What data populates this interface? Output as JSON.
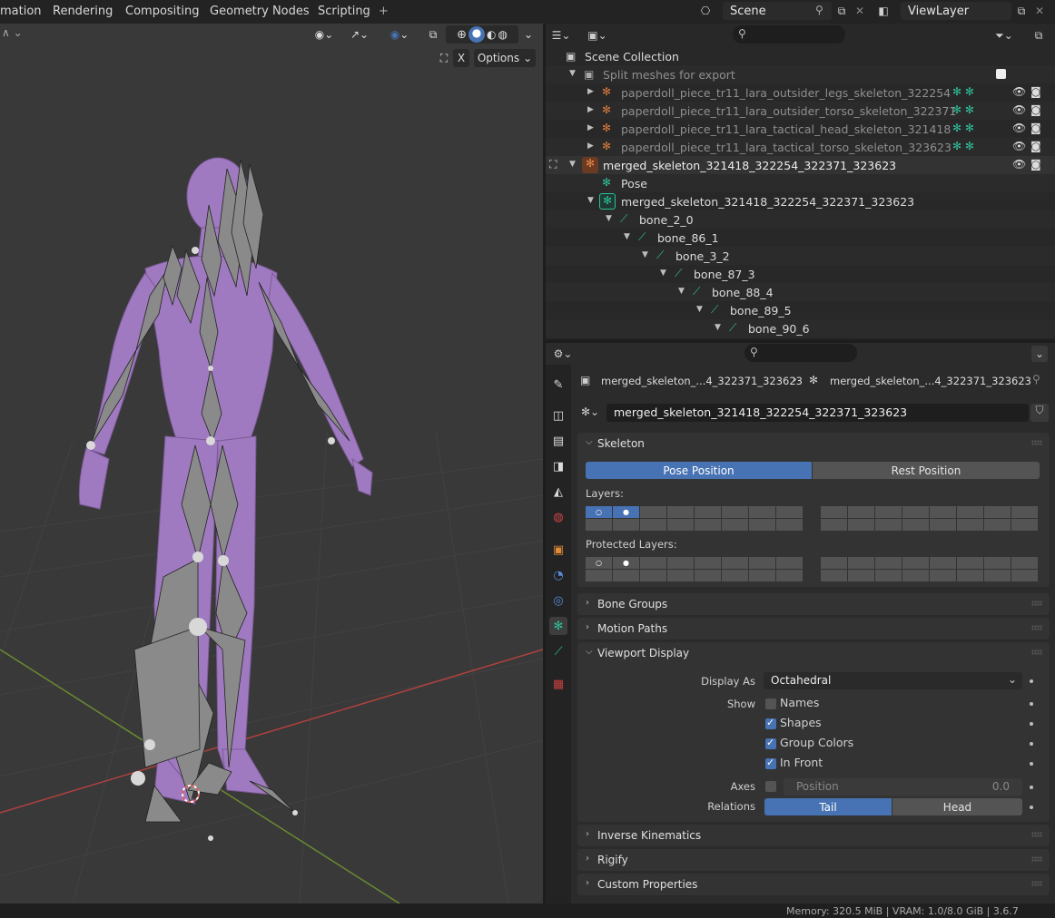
{
  "topbar": {
    "tabs": [
      "mation",
      "Rendering",
      "Compositing",
      "Geometry Nodes",
      "Scripting",
      "+"
    ],
    "scene": "Scene",
    "view_layer": "ViewLayer"
  },
  "viewport": {
    "options_label": "Options",
    "x_label": "X"
  },
  "outliner": {
    "rows": [
      {
        "label": "Scene Collection",
        "style": "normal"
      },
      {
        "label": "Split meshes for export",
        "style": "dim"
      },
      {
        "label": "paperdoll_piece_tr11_lara_outsider_legs_skeleton_322254",
        "style": "dim"
      },
      {
        "label": "paperdoll_piece_tr11_lara_outsider_torso_skeleton_322371",
        "style": "dim"
      },
      {
        "label": "paperdoll_piece_tr11_lara_tactical_head_skeleton_321418",
        "style": "dim"
      },
      {
        "label": "paperdoll_piece_tr11_lara_tactical_torso_skeleton_323623",
        "style": "dim"
      },
      {
        "label": "merged_skeleton_321418_322254_322371_323623",
        "style": "normal"
      },
      {
        "label": "Pose",
        "style": "normal"
      },
      {
        "label": "merged_skeleton_321418_322254_322371_323623",
        "style": "normal"
      },
      {
        "label": "bone_2_0",
        "style": "normal"
      },
      {
        "label": "bone_86_1",
        "style": "normal"
      },
      {
        "label": "bone_3_2",
        "style": "normal"
      },
      {
        "label": "bone_87_3",
        "style": "normal"
      },
      {
        "label": "bone_88_4",
        "style": "normal"
      },
      {
        "label": "bone_89_5",
        "style": "normal"
      },
      {
        "label": "bone_90_6",
        "style": "normal"
      }
    ]
  },
  "properties": {
    "breadcrumb_object": "merged_skeleton_...4_322371_323623",
    "breadcrumb_data": "merged_skeleton_...4_322371_323623",
    "datablock_name": "merged_skeleton_321418_322254_322371_323623",
    "skeleton": {
      "title": "Skeleton",
      "pose_position": "Pose Position",
      "rest_position": "Rest Position",
      "layers_label": "Layers:",
      "protected_label": "Protected Layers:"
    },
    "panels": {
      "bone_groups": "Bone Groups",
      "motion_paths": "Motion Paths",
      "viewport_display": "Viewport Display",
      "inverse_kinematics": "Inverse Kinematics",
      "rigify": "Rigify",
      "custom_properties": "Custom Properties"
    },
    "viewport_display": {
      "display_as_label": "Display As",
      "display_as_value": "Octahedral",
      "show_label": "Show",
      "names": "Names",
      "shapes": "Shapes",
      "group_colors": "Group Colors",
      "in_front": "In Front",
      "axes_label": "Axes",
      "position_label": "Position",
      "position_value": "0.0",
      "relations_label": "Relations",
      "tail": "Tail",
      "head": "Head"
    }
  },
  "statusbar": {
    "text": "Memory: 320.5 MiB | VRAM: 1.0/8.0 GiB | 3.6.7"
  },
  "colors": {
    "accent_blue": "#4772b3",
    "bone_green": "#2fbf9a",
    "mesh_purple": "#a07ac0"
  }
}
